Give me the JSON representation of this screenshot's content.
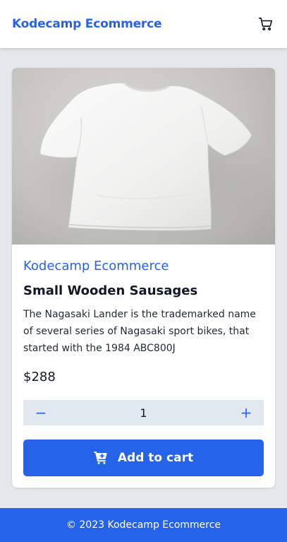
{
  "header": {
    "brand": "Kodecamp Ecommerce",
    "cart_icon": "shopping-cart-icon"
  },
  "product": {
    "image_alt": "white t-shirt",
    "store_name": "Kodecamp Ecommerce",
    "title": "Small Wooden Sausages",
    "description": "The Nagasaki Lander is the trademarked name of several series of Nagasaki sport bikes, that started with the 1984 ABC800J",
    "price": "$288",
    "quantity": "1",
    "decrement_label": "−",
    "increment_label": "+",
    "add_to_cart_label": "Add to cart",
    "add_to_cart_icon": "cart-plus-icon"
  },
  "footer": {
    "copyright": "© 2023 Kodecamp Ecommerce"
  },
  "colors": {
    "brand": "#2563eb",
    "page_bg": "#e5e7eb",
    "quantity_bg": "#e2e8f0"
  }
}
